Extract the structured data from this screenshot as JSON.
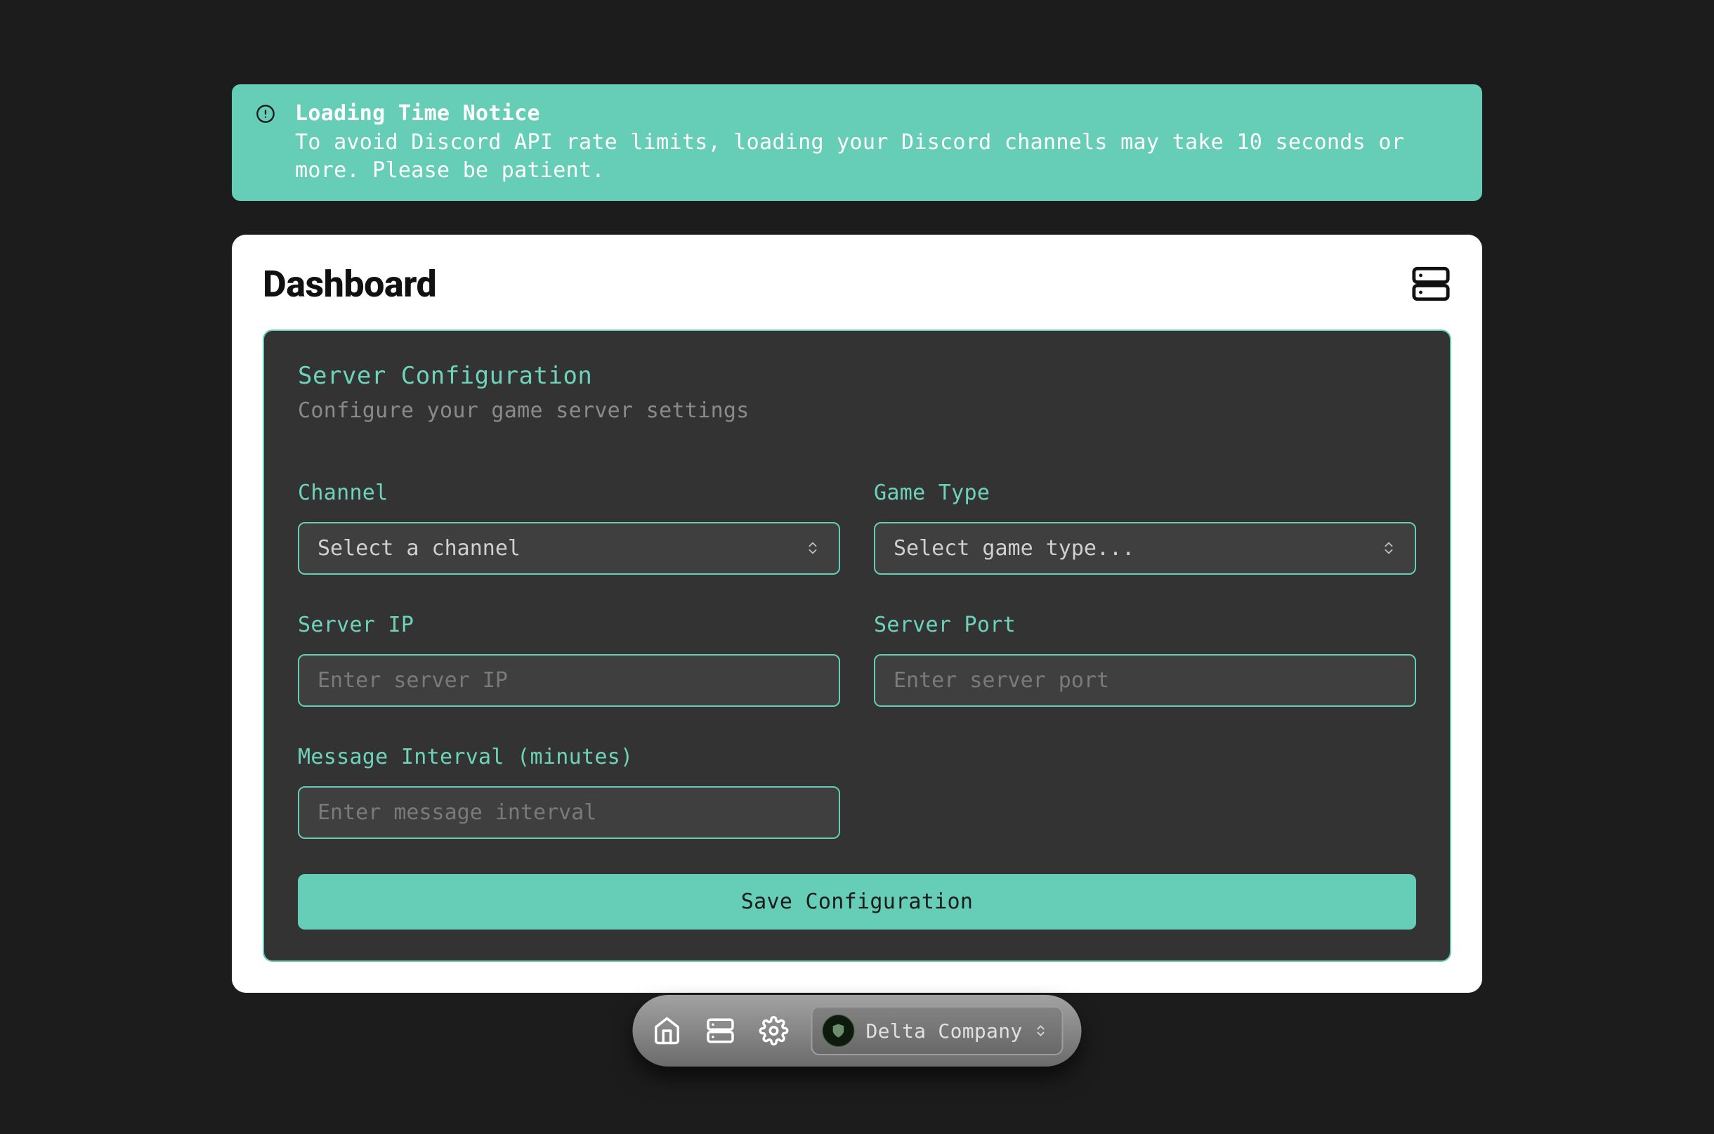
{
  "notice": {
    "title": "Loading Time Notice",
    "body": "To avoid Discord API rate limits, loading your Discord channels may take 10 seconds or more. Please be patient."
  },
  "dashboard": {
    "title": "Dashboard"
  },
  "panel": {
    "title": "Server Configuration",
    "subtitle": "Configure your game server settings"
  },
  "fields": {
    "channel": {
      "label": "Channel",
      "value": "Select a channel"
    },
    "gameType": {
      "label": "Game Type",
      "value": "Select game type..."
    },
    "serverIp": {
      "label": "Server IP",
      "placeholder": "Enter server IP"
    },
    "serverPort": {
      "label": "Server Port",
      "placeholder": "Enter server port"
    },
    "interval": {
      "label": "Message Interval (minutes)",
      "placeholder": "Enter message interval"
    }
  },
  "actions": {
    "save": "Save Configuration"
  },
  "dock": {
    "selected": "Delta Company"
  },
  "colors": {
    "accent": "#66cdb6",
    "bg": "#1c1c1c",
    "panel": "#333333"
  }
}
